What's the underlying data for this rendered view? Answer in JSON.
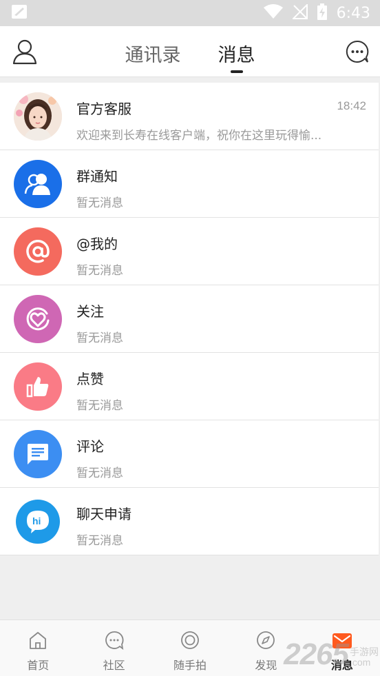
{
  "status_bar": {
    "time": "6:43"
  },
  "header": {
    "tabs": [
      {
        "label": "通讯录",
        "active": false
      },
      {
        "label": "消息",
        "active": true
      }
    ]
  },
  "messages": [
    {
      "title": "官方客服",
      "subtitle": "欢迎来到长寿在线客户端，祝你在这里玩得愉...",
      "time": "18:42",
      "icon": "customer-service-avatar",
      "color": "#f3c6b8"
    },
    {
      "title": "群通知",
      "subtitle": "暂无消息",
      "icon": "group-icon",
      "color": "#1a6fe8"
    },
    {
      "title": "@我的",
      "subtitle": "暂无消息",
      "icon": "at-icon",
      "color": "#f46a5e"
    },
    {
      "title": "关注",
      "subtitle": "暂无消息",
      "icon": "heart-icon",
      "color": "#cf67b4"
    },
    {
      "title": "点赞",
      "subtitle": "暂无消息",
      "icon": "thumbs-up-icon",
      "color": "#fa7b86"
    },
    {
      "title": "评论",
      "subtitle": "暂无消息",
      "icon": "comment-icon",
      "color": "#3c8ef2"
    },
    {
      "title": "聊天申请",
      "subtitle": "暂无消息",
      "icon": "hi-chat-icon",
      "color": "#1e9ae8"
    }
  ],
  "bottom_nav": [
    {
      "label": "首页",
      "icon": "home-icon",
      "active": false
    },
    {
      "label": "社区",
      "icon": "community-icon",
      "active": false
    },
    {
      "label": "随手拍",
      "icon": "camera-icon",
      "active": false
    },
    {
      "label": "发现",
      "icon": "discover-icon",
      "active": false
    },
    {
      "label": "消息",
      "icon": "message-icon",
      "active": true
    }
  ],
  "watermark": {
    "number": "2265",
    "text_line1": "手游网",
    "text_line2": ".com"
  },
  "colors": {
    "accent": "#ff5a1f",
    "background": "#efefef",
    "status_bar": "#dcdcdc"
  }
}
